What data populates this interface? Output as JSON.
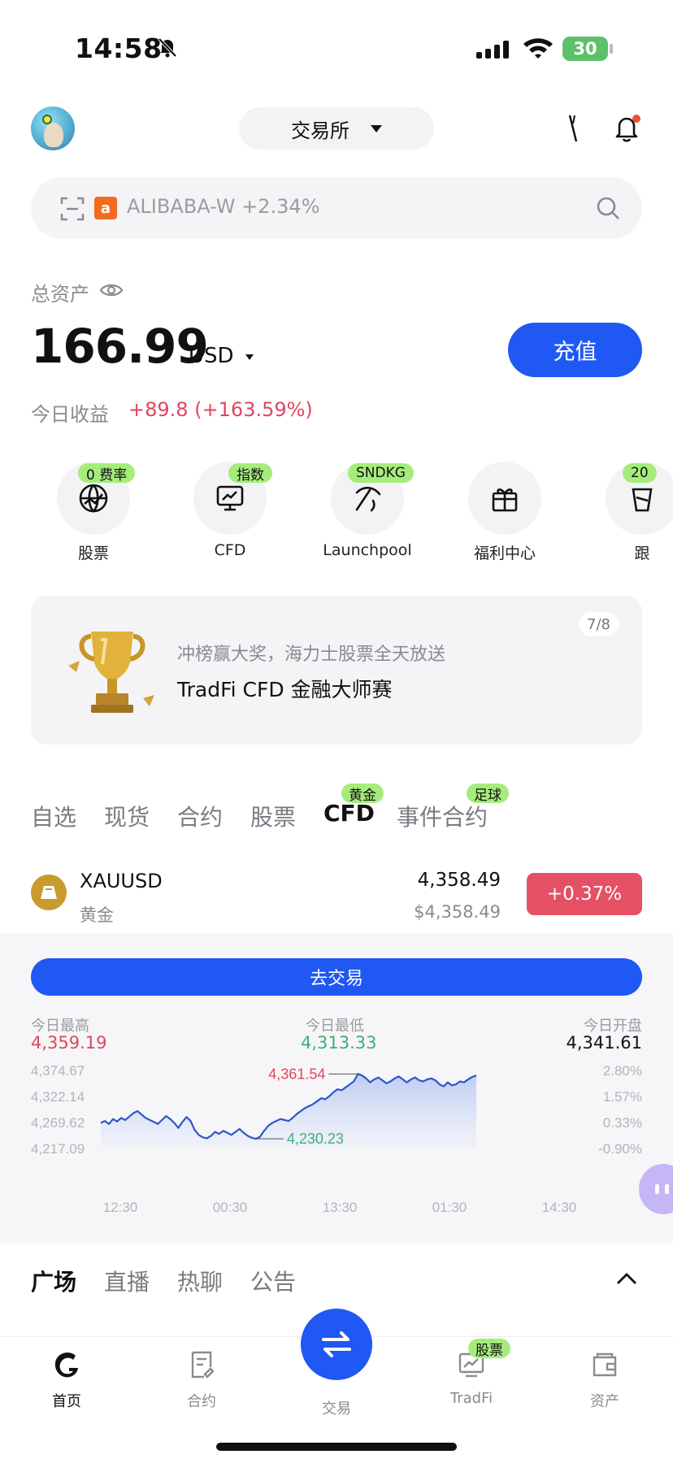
{
  "status": {
    "time": "14:58",
    "battery": "30"
  },
  "header": {
    "exchange_label": "交易所"
  },
  "search": {
    "ticker_text": "ALIBABA-W +2.34%"
  },
  "account": {
    "total_label": "总资产",
    "total_value": "166.99",
    "currency": "USD",
    "deposit_label": "充值",
    "pnl_label": "今日收益",
    "pnl_value": "+89.8 (+163.59%)"
  },
  "quick": [
    {
      "label": "股票",
      "badge": "0 费率",
      "icon": "globe-icon"
    },
    {
      "label": "CFD",
      "badge": "指数",
      "icon": "chart-board-icon"
    },
    {
      "label": "Launchpool",
      "badge": "SNDKG",
      "icon": "pickaxe-icon"
    },
    {
      "label": "福利中心",
      "badge": "",
      "icon": "gift-icon"
    },
    {
      "label": "跟",
      "badge": "20",
      "icon": "copy-trade-icon"
    }
  ],
  "banner": {
    "subtitle": "冲榜赢大奖，海力士股票全天放送",
    "title": "TradFi CFD 金融大师赛",
    "page": "7/8"
  },
  "tabs": [
    {
      "label": "自选",
      "badge": ""
    },
    {
      "label": "现货",
      "badge": ""
    },
    {
      "label": "合约",
      "badge": ""
    },
    {
      "label": "股票",
      "badge": ""
    },
    {
      "label": "CFD",
      "badge": "黄金"
    },
    {
      "label": "事件合约",
      "badge": "足球"
    }
  ],
  "asset": {
    "symbol": "XAUUSD",
    "name": "黄金",
    "price": "4,358.49",
    "price_usd": "$4,358.49",
    "change": "+0.37%"
  },
  "detail": {
    "trade_label": "去交易",
    "high_label": "今日最高",
    "high_value": "4,359.19",
    "low_label": "今日最低",
    "low_value": "4,313.33",
    "open_label": "今日开盘",
    "open_value": "4,341.61"
  },
  "chart_data": {
    "type": "area",
    "y_ticks": [
      "4,374.67",
      "4,322.14",
      "4,269.62",
      "4,217.09"
    ],
    "y_pct_ticks": [
      "2.80%",
      "1.57%",
      "0.33%",
      "-0.90%"
    ],
    "x_ticks": [
      "12:30",
      "00:30",
      "13:30",
      "01:30",
      "14:30"
    ],
    "ylim": [
      4217.09,
      4374.67
    ],
    "max_label": "4,361.54",
    "min_label": "4,230.23",
    "values": [
      4262,
      4266,
      4260,
      4270,
      4265,
      4272,
      4268,
      4275,
      4282,
      4286,
      4279,
      4272,
      4268,
      4264,
      4260,
      4268,
      4276,
      4270,
      4262,
      4252,
      4264,
      4274,
      4266,
      4248,
      4238,
      4233,
      4231,
      4236,
      4244,
      4240,
      4246,
      4242,
      4238,
      4244,
      4250,
      4242,
      4236,
      4232,
      4230,
      4234,
      4246,
      4256,
      4262,
      4266,
      4270,
      4268,
      4266,
      4272,
      4280,
      4286,
      4292,
      4296,
      4300,
      4306,
      4312,
      4310,
      4316,
      4324,
      4330,
      4328,
      4334,
      4340,
      4346,
      4361,
      4358,
      4352,
      4344,
      4350,
      4354,
      4348,
      4342,
      4346,
      4352,
      4356,
      4350,
      4344,
      4350,
      4354,
      4348,
      4346,
      4350,
      4352,
      4348,
      4340,
      4336,
      4344,
      4338,
      4340,
      4346,
      4344,
      4350,
      4355,
      4358
    ]
  },
  "feed_tabs": [
    "广场",
    "直播",
    "热聊",
    "公告"
  ],
  "nav": [
    {
      "label": "首页"
    },
    {
      "label": "合约"
    },
    {
      "label": "交易"
    },
    {
      "label": "TradFi",
      "badge": "股票"
    },
    {
      "label": "资产"
    }
  ]
}
